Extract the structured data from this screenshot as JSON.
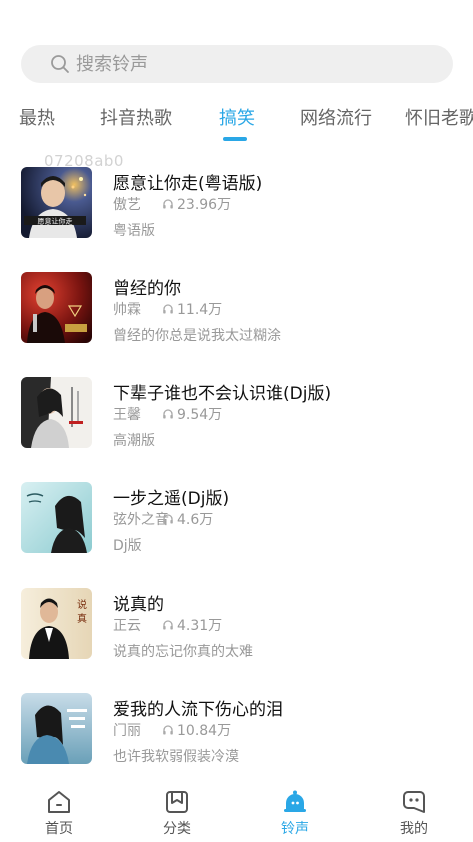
{
  "search": {
    "placeholder": "搜索铃声",
    "icon": "search-icon"
  },
  "tabs": [
    {
      "label": "最热",
      "active": false
    },
    {
      "label": "抖音热歌",
      "active": false
    },
    {
      "label": "搞笑",
      "active": true
    },
    {
      "label": "网络流行",
      "active": false
    },
    {
      "label": "怀旧老歌",
      "active": false
    }
  ],
  "watermark": "07208ab0",
  "songs": [
    {
      "title": "愿意让你走(粤语版)",
      "artist": "傲艺",
      "plays": "23.96万",
      "desc": "粤语版"
    },
    {
      "title": "曾经的你",
      "artist": "帅霖",
      "plays": "11.4万",
      "desc": "曾经的你总是说我太过糊涂"
    },
    {
      "title": "下辈子谁也不会认识谁(Dj版)",
      "artist": "王馨",
      "plays": "9.54万",
      "desc": "高潮版"
    },
    {
      "title": "一步之遥(Dj版)",
      "artist": "弦外之音",
      "plays": "4.6万",
      "desc": "Dj版"
    },
    {
      "title": "说真的",
      "artist": "正云",
      "plays": "4.31万",
      "desc": "说真的忘记你真的太难"
    },
    {
      "title": "爱我的人流下伤心的泪",
      "artist": "门丽",
      "plays": "10.84万",
      "desc": "也许我软弱假装冷漠"
    }
  ],
  "cover_text": {
    "song1": "愿意让你走"
  },
  "nav": [
    {
      "label": "首页",
      "icon": "home-icon",
      "active": false
    },
    {
      "label": "分类",
      "icon": "category-icon",
      "active": false
    },
    {
      "label": "铃声",
      "icon": "bell-icon",
      "active": true
    },
    {
      "label": "我的",
      "icon": "profile-icon",
      "active": false
    }
  ],
  "colors": {
    "accent": "#2aa7e6",
    "search_bg": "#efefef",
    "muted": "#999999"
  }
}
